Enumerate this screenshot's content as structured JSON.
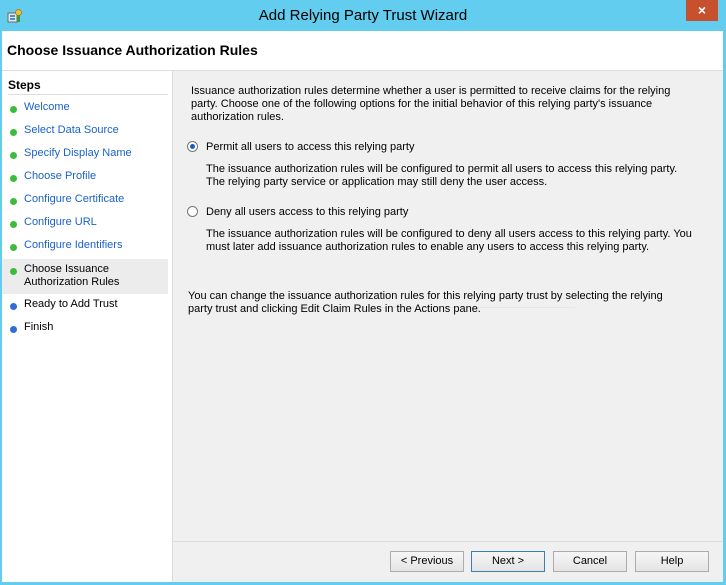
{
  "window": {
    "title": "Add Relying Party Trust Wizard",
    "close_label": "×",
    "titlebar_color": "#62cdee",
    "close_color": "#c7502f"
  },
  "header": {
    "title": "Choose Issuance Authorization Rules"
  },
  "steps": {
    "title": "Steps",
    "items": [
      {
        "label": "Welcome",
        "state": "done"
      },
      {
        "label": "Select Data Source",
        "state": "done"
      },
      {
        "label": "Specify Display Name",
        "state": "done"
      },
      {
        "label": "Choose Profile",
        "state": "done"
      },
      {
        "label": "Configure Certificate",
        "state": "done"
      },
      {
        "label": "Configure URL",
        "state": "done"
      },
      {
        "label": "Configure Identifiers",
        "state": "done"
      },
      {
        "label": "Choose Issuance\nAuthorization Rules",
        "state": "current"
      },
      {
        "label": "Ready to Add Trust",
        "state": "todo"
      },
      {
        "label": "Finish",
        "state": "todo"
      }
    ]
  },
  "main": {
    "intro": "Issuance authorization rules determine whether a user is permitted to receive claims for the relying party. Choose one of the following options for the initial behavior of this relying party's issuance authorization rules.",
    "options": [
      {
        "label": "Permit all users to access this relying party",
        "description": "The issuance authorization rules will be configured to permit all users to access this relying party. The relying party service or application may still deny the user access.",
        "selected": true
      },
      {
        "label": "Deny all users access to this relying party",
        "description": "The issuance authorization rules will be configured to deny all users access to this relying party. You must later add issuance authorization rules to enable any users to access this relying party.",
        "selected": false
      }
    ],
    "note": "You can change the issuance authorization rules for this relying party trust by selecting the relying party trust and clicking Edit Claim Rules in the Actions pane."
  },
  "footer": {
    "previous_label": "< Previous",
    "next_label": "Next >",
    "cancel_label": "Cancel",
    "help_label": "Help"
  }
}
